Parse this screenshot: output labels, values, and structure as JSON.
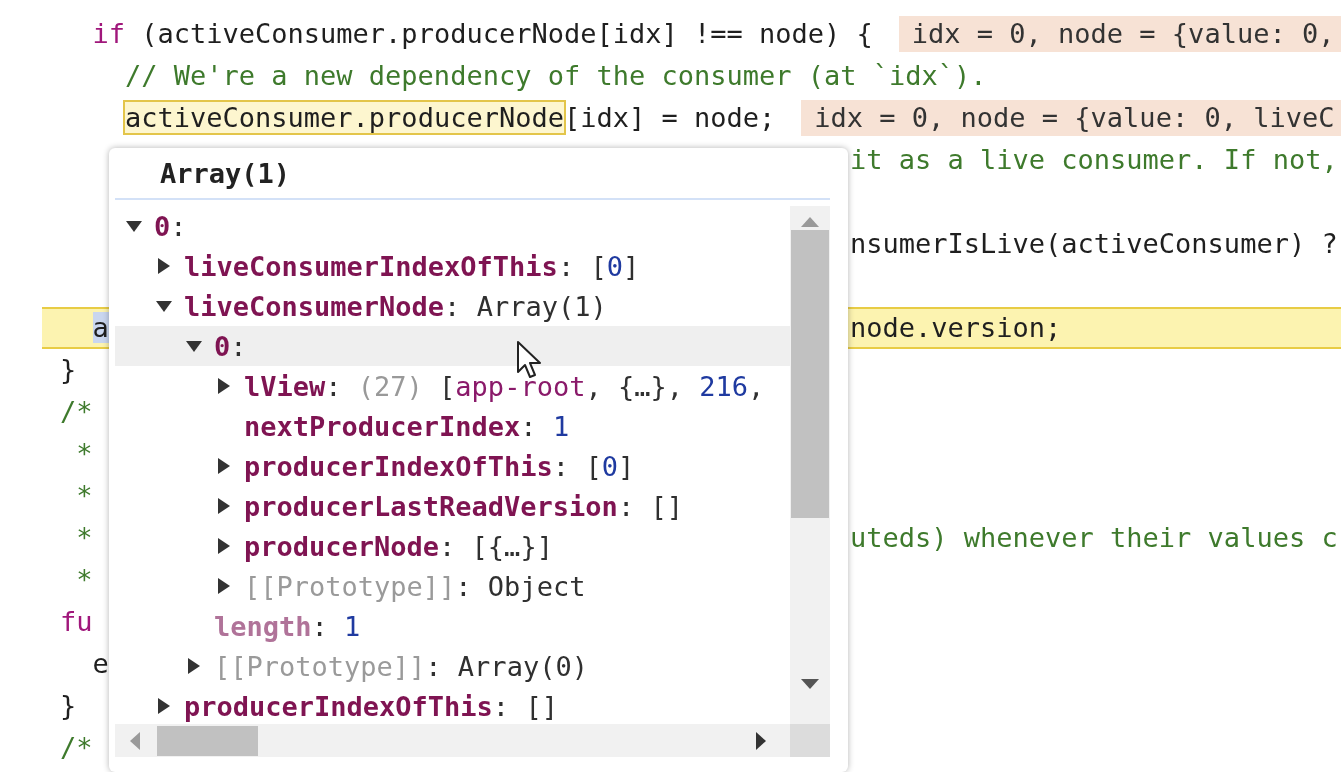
{
  "editor": {
    "lines": [
      {
        "paused": false,
        "tokens": [
          {
            "text": "  if",
            "kind": "keyword"
          },
          {
            "text": " (activeConsumer.producerNode[idx] !== node) {",
            "kind": "plain"
          }
        ],
        "inline_value": "idx = 0, node = {value: 0,"
      },
      {
        "paused": false,
        "tokens": [
          {
            "text": "    // We're a new dependency of the consumer (at `idx`).",
            "kind": "comment"
          }
        ]
      },
      {
        "paused": false,
        "tokens": [
          {
            "text": "    activeConsumer.producerNode",
            "kind": "hover"
          },
          {
            "text": "[idx] = node;",
            "kind": "plain"
          }
        ],
        "inline_value": "idx = 0, node = {value: 0, liveC"
      },
      {
        "paused": false,
        "right": [
          {
            "text": "it as a live consumer. If not,",
            "kind": "comment"
          }
        ]
      },
      {
        "paused": false,
        "blank_before": true,
        "right": [
          {
            "text": "nsumerIsLive(activeConsumer) ?",
            "kind": "plain"
          }
        ]
      },
      {
        "paused": true,
        "blank_before": true,
        "tokens": [
          {
            "text": "  a",
            "kind": "selection"
          }
        ],
        "right": [
          {
            "text": "node.version;",
            "kind": "plain"
          }
        ]
      },
      {
        "paused": false,
        "tokens": [
          {
            "text": "}",
            "kind": "plain"
          }
        ]
      },
      {
        "paused": false,
        "tokens": [
          {
            "text": "/*",
            "kind": "comment"
          }
        ]
      },
      {
        "paused": false,
        "tokens": [
          {
            "text": " *",
            "kind": "comment"
          }
        ]
      },
      {
        "paused": false,
        "tokens": [
          {
            "text": " *",
            "kind": "comment"
          }
        ]
      },
      {
        "paused": false,
        "tokens": [
          {
            "text": " *",
            "kind": "comment"
          }
        ],
        "right": [
          {
            "text": "uteds) whenever their values c",
            "kind": "comment"
          }
        ]
      },
      {
        "paused": false,
        "tokens": [
          {
            "text": " *",
            "kind": "comment"
          }
        ]
      },
      {
        "paused": false,
        "tokens": [
          {
            "text": "fu",
            "kind": "keyword"
          }
        ]
      },
      {
        "paused": false,
        "tokens": [
          {
            "text": "  e",
            "kind": "plain"
          }
        ]
      },
      {
        "paused": false,
        "tokens": [
          {
            "text": "}",
            "kind": "plain"
          }
        ]
      },
      {
        "paused": false,
        "tokens": [
          {
            "text": "/*",
            "kind": "comment"
          }
        ]
      }
    ]
  },
  "popover": {
    "title": "Array(1)",
    "tree": [
      {
        "key": "0",
        "kind": "own",
        "expanded": true,
        "hovered": false,
        "value": [
          {
            "text": ":",
            "kind": "punct"
          }
        ],
        "children": [
          {
            "key": "liveConsumerIndexOfThis",
            "kind": "own",
            "expanded": false,
            "hovered": false,
            "value": [
              {
                "text": ":",
                "kind": "punct"
              },
              {
                "text": "[",
                "kind": "punct"
              },
              {
                "text": "0",
                "kind": "number"
              },
              {
                "text": "]",
                "kind": "punct"
              }
            ]
          },
          {
            "key": "liveConsumerNode",
            "kind": "own",
            "expanded": true,
            "hovered": false,
            "value": [
              {
                "text": ":",
                "kind": "punct"
              },
              {
                "text": "Array(1)",
                "kind": "punct"
              }
            ],
            "children": [
              {
                "key": "0",
                "kind": "own",
                "expanded": true,
                "hovered": true,
                "value": [
                  {
                    "text": ":",
                    "kind": "punct"
                  }
                ],
                "children": [
                  {
                    "key": "lView",
                    "kind": "own",
                    "expanded": false,
                    "hovered": false,
                    "value": [
                      {
                        "text": ":",
                        "kind": "punct"
                      },
                      {
                        "text": "(27)",
                        "kind": "dim"
                      },
                      {
                        "text": " [",
                        "kind": "punct"
                      },
                      {
                        "text": "app-root",
                        "kind": "string"
                      },
                      {
                        "text": ", {…}, ",
                        "kind": "punct"
                      },
                      {
                        "text": "216",
                        "kind": "number"
                      },
                      {
                        "text": ",",
                        "kind": "punct"
                      }
                    ]
                  },
                  {
                    "key": "nextProducerIndex",
                    "kind": "own",
                    "hovered": false,
                    "value": [
                      {
                        "text": ":",
                        "kind": "punct"
                      },
                      {
                        "text": "1",
                        "kind": "number"
                      }
                    ]
                  },
                  {
                    "key": "producerIndexOfThis",
                    "kind": "own",
                    "expanded": false,
                    "hovered": false,
                    "value": [
                      {
                        "text": ":",
                        "kind": "punct"
                      },
                      {
                        "text": "[",
                        "kind": "punct"
                      },
                      {
                        "text": "0",
                        "kind": "number"
                      },
                      {
                        "text": "]",
                        "kind": "punct"
                      }
                    ]
                  },
                  {
                    "key": "producerLastReadVersion",
                    "kind": "own",
                    "expanded": false,
                    "hovered": false,
                    "value": [
                      {
                        "text": ":",
                        "kind": "punct"
                      },
                      {
                        "text": "[]",
                        "kind": "punct"
                      }
                    ]
                  },
                  {
                    "key": "producerNode",
                    "kind": "own",
                    "expanded": false,
                    "hovered": false,
                    "value": [
                      {
                        "text": ":",
                        "kind": "punct"
                      },
                      {
                        "text": "[{…}]",
                        "kind": "punct"
                      }
                    ]
                  },
                  {
                    "key": "[[Prototype]]",
                    "kind": "internal",
                    "expanded": false,
                    "hovered": false,
                    "value": [
                      {
                        "text": ":",
                        "kind": "punct"
                      },
                      {
                        "text": "Object",
                        "kind": "punct"
                      }
                    ]
                  }
                ]
              },
              {
                "key": "length",
                "kind": "nonenumerable",
                "hovered": false,
                "value": [
                  {
                    "text": ":",
                    "kind": "punct"
                  },
                  {
                    "text": "1",
                    "kind": "number"
                  }
                ]
              },
              {
                "key": "[[Prototype]]",
                "kind": "internal",
                "expanded": false,
                "hovered": false,
                "value": [
                  {
                    "text": ":",
                    "kind": "punct"
                  },
                  {
                    "text": "Array(0)",
                    "kind": "punct"
                  }
                ]
              }
            ]
          },
          {
            "key": "producerIndexOfThis",
            "kind": "own",
            "expanded": false,
            "hovered": false,
            "value": [
              {
                "text": ":",
                "kind": "punct"
              },
              {
                "text": "[]",
                "kind": "punct"
              }
            ]
          }
        ]
      }
    ]
  }
}
